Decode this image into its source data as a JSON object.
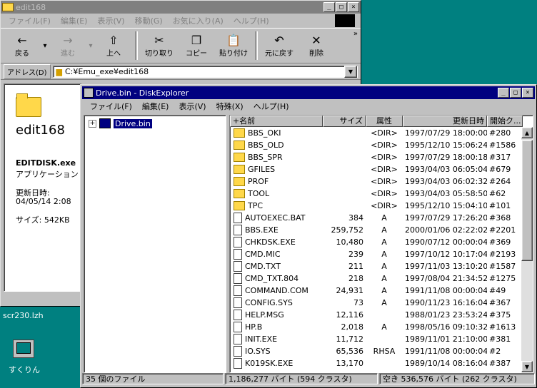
{
  "back_window": {
    "title": "edit168",
    "menu": [
      "ファイル(F)",
      "編集(E)",
      "表示(V)",
      "移動(G)",
      "お気に入り(A)",
      "ヘルプ(H)"
    ],
    "toolbar": [
      {
        "label": "戻る",
        "icon": "←"
      },
      {
        "label": "進む",
        "icon": "→"
      },
      {
        "label": "上へ",
        "icon": "⇧"
      },
      {
        "label": "切り取り",
        "icon": "✂"
      },
      {
        "label": "コピー",
        "icon": "❐"
      },
      {
        "label": "貼り付け",
        "icon": "📋"
      },
      {
        "label": "元に戻す",
        "icon": "↶"
      },
      {
        "label": "削除",
        "icon": "✕"
      }
    ],
    "address_label": "アドレス(D)",
    "address_value": "C:¥Emu_exe¥edit168",
    "side": {
      "title": "edit168",
      "file_name": "EDITDISK.exe",
      "file_type": "アプリケーション",
      "modified_label": "更新日時:",
      "modified_value": "04/05/14 2:08",
      "size": "サイズ: 542KB"
    }
  },
  "desktop": {
    "file_label": "scr230.lzh",
    "icon_label": "すくりん"
  },
  "front_window": {
    "title": "Drive.bin - DiskExplorer",
    "menu": [
      "ファイル(F)",
      "編集(E)",
      "表示(V)",
      "特殊(X)",
      "ヘルプ(H)"
    ],
    "tree_root": "Drive.bin",
    "columns": [
      "+名前",
      "サイズ",
      "属性",
      "更新日時",
      "開始ク..."
    ],
    "rows": [
      {
        "type": "folder",
        "name": "BBS_OKI",
        "size": "",
        "attr": "<DIR>",
        "date": "1997/07/29 18:00:00",
        "start": "#280"
      },
      {
        "type": "folder",
        "name": "BBS_OLD",
        "size": "",
        "attr": "<DIR>",
        "date": "1995/12/10 15:06:24",
        "start": "#1586"
      },
      {
        "type": "folder",
        "name": "BBS_SPR",
        "size": "",
        "attr": "<DIR>",
        "date": "1997/07/29 18:00:18",
        "start": "#317"
      },
      {
        "type": "folder",
        "name": "GFILES",
        "size": "",
        "attr": "<DIR>",
        "date": "1993/04/03 06:05:04",
        "start": "#679"
      },
      {
        "type": "folder",
        "name": "PROF",
        "size": "",
        "attr": "<DIR>",
        "date": "1993/04/03 06:02:32",
        "start": "#264"
      },
      {
        "type": "folder",
        "name": "TOOL",
        "size": "",
        "attr": "<DIR>",
        "date": "1993/04/03 05:58:50",
        "start": "#62"
      },
      {
        "type": "folder",
        "name": "TPC",
        "size": "",
        "attr": "<DIR>",
        "date": "1995/12/10 15:04:10",
        "start": "#101"
      },
      {
        "type": "file",
        "name": "AUTOEXEC.BAT",
        "size": "384",
        "attr": "A",
        "date": "1997/07/29 17:26:20",
        "start": "#368"
      },
      {
        "type": "file",
        "name": "BBS.EXE",
        "size": "259,752",
        "attr": "A",
        "date": "2000/01/06 02:22:02",
        "start": "#2201"
      },
      {
        "type": "file",
        "name": "CHKDSK.EXE",
        "size": "10,480",
        "attr": "A",
        "date": "1990/07/12 00:00:04",
        "start": "#369"
      },
      {
        "type": "file",
        "name": "CMD.MIC",
        "size": "239",
        "attr": "A",
        "date": "1997/10/12 10:17:04",
        "start": "#2193"
      },
      {
        "type": "file",
        "name": "CMD.TXT",
        "size": "211",
        "attr": "A",
        "date": "1997/11/03 13:10:20",
        "start": "#1587"
      },
      {
        "type": "file",
        "name": "CMD_TXT.804",
        "size": "218",
        "attr": "A",
        "date": "1997/08/04 21:34:52",
        "start": "#1275"
      },
      {
        "type": "file",
        "name": "COMMAND.COM",
        "size": "24,931",
        "attr": "A",
        "date": "1991/11/08 00:00:04",
        "start": "#49"
      },
      {
        "type": "file",
        "name": "CONFIG.SYS",
        "size": "73",
        "attr": "A",
        "date": "1990/11/23 16:16:04",
        "start": "#367"
      },
      {
        "type": "file",
        "name": "HELP.MSG",
        "size": "12,116",
        "attr": "",
        "date": "1988/01/23 23:53:24",
        "start": "#375"
      },
      {
        "type": "file",
        "name": "HP.B",
        "size": "2,018",
        "attr": "A",
        "date": "1998/05/16 09:10:32",
        "start": "#1613"
      },
      {
        "type": "file",
        "name": "INIT.EXE",
        "size": "11,712",
        "attr": "",
        "date": "1989/11/01 21:10:00",
        "start": "#381"
      },
      {
        "type": "file",
        "name": "IO.SYS",
        "size": "65,536",
        "attr": "RHSA",
        "date": "1991/11/08 00:00:04",
        "start": "#2"
      },
      {
        "type": "file",
        "name": "K019SK.EXE",
        "size": "13,170",
        "attr": "",
        "date": "1989/10/14 08:16:04",
        "start": "#387"
      }
    ],
    "status": {
      "count": "35 個のファイル",
      "used": "1,186,277 バイト (594 クラスタ)",
      "free": "空き 536,576 バイト (262 クラスタ)"
    }
  }
}
